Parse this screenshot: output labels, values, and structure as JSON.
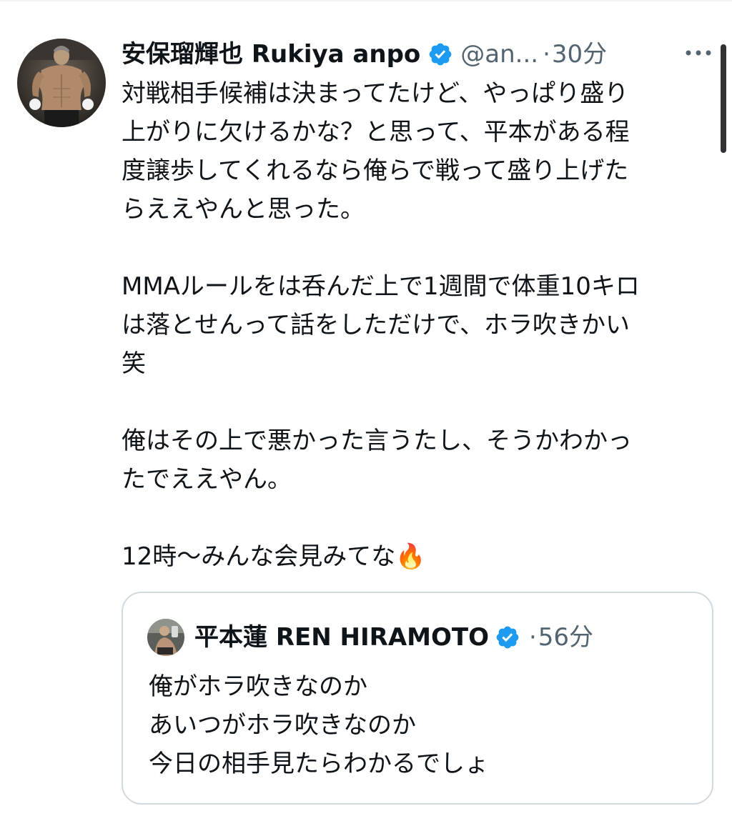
{
  "tweet": {
    "display_name": "安保瑠輝也 Rukiya anpo",
    "handle": "@an...",
    "separator": "·",
    "time": "30分",
    "body": "対戦相手候補は決まってたけど、やっぱり盛り\n上がりに欠けるかな？と思って、平本がある程\n度譲歩してくれるなら俺らで戦って盛り上げた\nらええやんと思った。\n\nMMAルールをは呑んだ上で1週間で体重10キロ\nは落とせんって話をしただけで、ホラ吹きかい\n笑\n\n俺はその上で悪かった言うたし、そうかわかっ\nたでええやん。\n\n12時〜みんな会見みてな🔥"
  },
  "quoted_tweet": {
    "display_name": "平本蓮 REN HIRAMOTO",
    "separator": "·",
    "time": "56分",
    "body": "俺がホラ吹きなのか\nあいつがホラ吹きなのか\n今日の相手見たらわかるでしょ"
  },
  "icons": {
    "verified": "verified-badge-icon",
    "more": "more-dots-icon",
    "fire": "fire-emoji"
  },
  "colors": {
    "verified": "#1d9bf0",
    "secondary_text": "#536471",
    "border": "#cfd9de"
  }
}
